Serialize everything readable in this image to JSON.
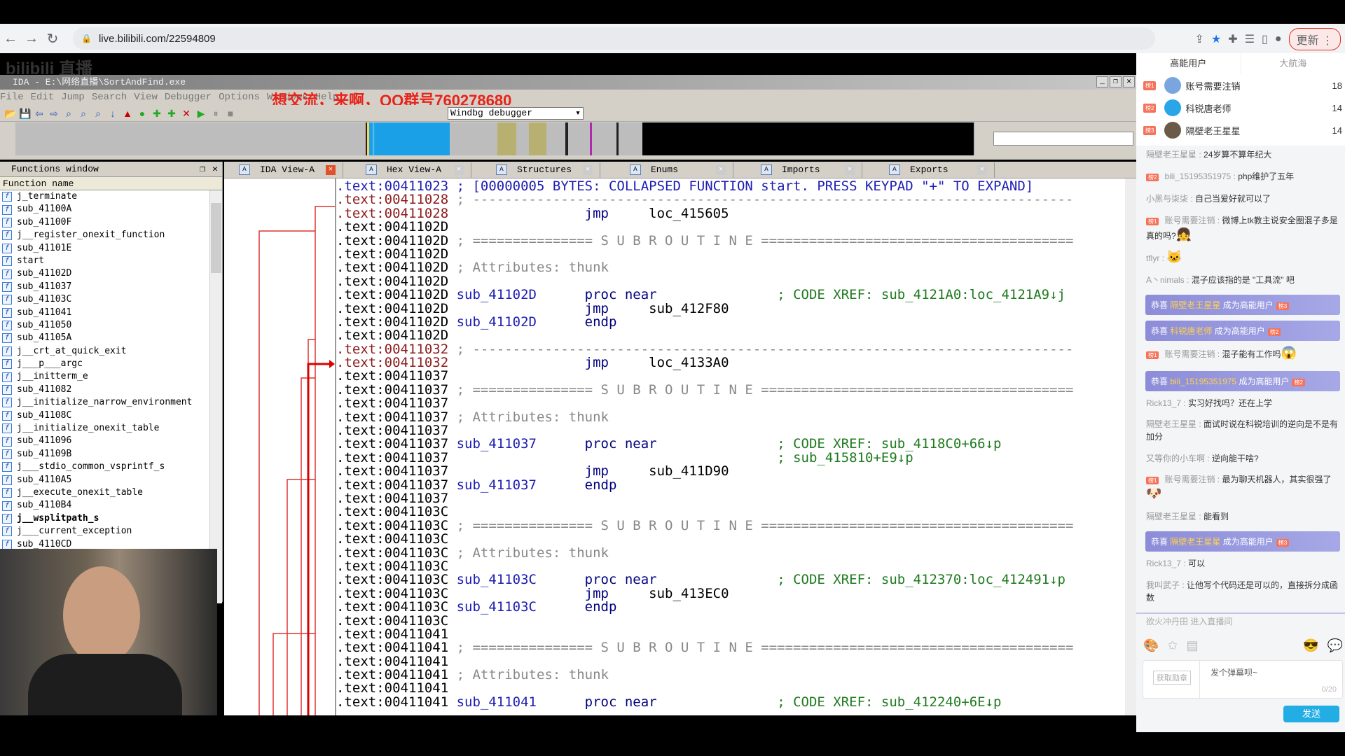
{
  "browser": {
    "url": "live.bilibili.com/22594809",
    "update_label": "更新",
    "icons": [
      "back-icon",
      "forward-icon",
      "reload-icon",
      "lock-icon",
      "share-icon",
      "star-icon",
      "extensions-icon",
      "reading-list-icon",
      "side-panel-icon",
      "profile-icon",
      "menu-icon"
    ]
  },
  "stream": {
    "watermark": "bilibili 直播",
    "overlay_text": "想交流，来啊，QQ群号760278680"
  },
  "ida": {
    "title": "IDA - E:\\网络直播\\SortAndFind.exe",
    "menu": [
      "File",
      "Edit",
      "Jump",
      "Search",
      "View",
      "Debugger",
      "Options",
      "Windows",
      "Help"
    ],
    "debugger_select": "Windbg debugger",
    "functions_window": {
      "title": "Functions window",
      "column": "Function name",
      "items": [
        "j_terminate",
        "sub_41100A",
        "sub_41100F",
        "j__register_onexit_function",
        "sub_41101E",
        "start",
        "sub_41102D",
        "sub_411037",
        "sub_41103C",
        "sub_411041",
        "sub_411050",
        "sub_41105A",
        "j__crt_at_quick_exit",
        "j___p___argc",
        "j__initterm_e",
        "sub_411082",
        "j__initialize_narrow_environment",
        "sub_41108C",
        "j__initialize_onexit_table",
        "sub_411096",
        "sub_41109B",
        "j___stdio_common_vsprintf_s",
        "sub_4110A5",
        "j__execute_onexit_table",
        "sub_4110B4",
        "j__wsplitpath_s",
        "j___current_exception",
        "sub_4110CD"
      ],
      "bold_item": "j__wsplitpath_s"
    },
    "tabs": [
      {
        "label": "IDA View-A",
        "active": true
      },
      {
        "label": "Hex View-A"
      },
      {
        "label": "Structures"
      },
      {
        "label": "Enums"
      },
      {
        "label": "Imports"
      },
      {
        "label": "Exports"
      }
    ],
    "colors": {
      "address_normal": "#000000",
      "address_unexplored": "#8b1c1c",
      "name": "#1c1cb4",
      "comment": "#1f7a1f",
      "overlay": "#e8231a"
    },
    "disasm": [
      {
        "addr": ".text:00411023",
        "ac": "a-blue",
        "text": "; [00000005 BYTES: COLLAPSED FUNCTION start. PRESS KEYPAD \"+\" TO EXPAND]",
        "tc": "c-blue"
      },
      {
        "addr": ".text:00411028",
        "ac": "a-red",
        "text": "; ---------------------------------------------------------------------------",
        "tc": "c-gray"
      },
      {
        "addr": ".text:00411028",
        "ac": "a-red",
        "op": "jmp",
        "arg": "loc_415605"
      },
      {
        "addr": ".text:0041102D"
      },
      {
        "addr": ".text:0041102D",
        "text": "; =============== S U B R O U T I N E =======================================",
        "tc": "c-gray"
      },
      {
        "addr": ".text:0041102D"
      },
      {
        "addr": ".text:0041102D",
        "text": "; Attributes: thunk",
        "tc": "c-gray"
      },
      {
        "addr": ".text:0041102D"
      },
      {
        "addr": ".text:0041102D",
        "label": "sub_41102D",
        "op": "proc near",
        "comment": "; CODE XREF: sub_4121A0:loc_4121A9↓j"
      },
      {
        "addr": ".text:0041102D",
        "op": "jmp",
        "arg": "sub_412F80"
      },
      {
        "addr": ".text:0041102D",
        "label": "sub_41102D",
        "op": "endp"
      },
      {
        "addr": ".text:0041102D"
      },
      {
        "addr": ".text:00411032",
        "ac": "a-red",
        "text": "; ---------------------------------------------------------------------------",
        "tc": "c-gray"
      },
      {
        "addr": ".text:00411032",
        "ac": "a-red",
        "op": "jmp",
        "arg": "loc_4133A0"
      },
      {
        "addr": ".text:00411037"
      },
      {
        "addr": ".text:00411037",
        "text": "; =============== S U B R O U T I N E =======================================",
        "tc": "c-gray"
      },
      {
        "addr": ".text:00411037"
      },
      {
        "addr": ".text:00411037",
        "text": "; Attributes: thunk",
        "tc": "c-gray"
      },
      {
        "addr": ".text:00411037"
      },
      {
        "addr": ".text:00411037",
        "label": "sub_411037",
        "op": "proc near",
        "comment": "; CODE XREF: sub_4118C0+66↓p"
      },
      {
        "addr": ".text:00411037",
        "comment": "; sub_415810+E9↓p"
      },
      {
        "addr": ".text:00411037",
        "op": "jmp",
        "arg": "sub_411D90"
      },
      {
        "addr": ".text:00411037",
        "label": "sub_411037",
        "op": "endp"
      },
      {
        "addr": ".text:00411037"
      },
      {
        "addr": ".text:0041103C"
      },
      {
        "addr": ".text:0041103C",
        "text": "; =============== S U B R O U T I N E =======================================",
        "tc": "c-gray"
      },
      {
        "addr": ".text:0041103C"
      },
      {
        "addr": ".text:0041103C",
        "text": "; Attributes: thunk",
        "tc": "c-gray"
      },
      {
        "addr": ".text:0041103C"
      },
      {
        "addr": ".text:0041103C",
        "label": "sub_41103C",
        "op": "proc near",
        "comment": "; CODE XREF: sub_412370:loc_412491↓p"
      },
      {
        "addr": ".text:0041103C",
        "op": "jmp",
        "arg": "sub_413EC0"
      },
      {
        "addr": ".text:0041103C",
        "label": "sub_41103C",
        "op": "endp"
      },
      {
        "addr": ".text:0041103C"
      },
      {
        "addr": ".text:00411041"
      },
      {
        "addr": ".text:00411041",
        "text": "; =============== S U B R O U T I N E =======================================",
        "tc": "c-gray"
      },
      {
        "addr": ".text:00411041"
      },
      {
        "addr": ".text:00411041",
        "text": "; Attributes: thunk",
        "tc": "c-gray"
      },
      {
        "addr": ".text:00411041"
      },
      {
        "addr": ".text:00411041",
        "label": "sub_411041",
        "op": "proc near",
        "comment": "; CODE XREF: sub_412240+6E↓p"
      }
    ]
  },
  "chat": {
    "tabs": [
      "高能用户",
      "大航海"
    ],
    "ranking": [
      {
        "badge": "榜1",
        "name": "账号需要注销",
        "value": "18",
        "avatar": "#7aa6e0"
      },
      {
        "badge": "榜2",
        "name": "科锐唐老师",
        "value": "14",
        "avatar": "#2aa5e8"
      },
      {
        "badge": "榜3",
        "name": "隔壁老王星星",
        "value": "14",
        "avatar": "#6b5a48"
      }
    ],
    "messages": [
      {
        "user": "隔壁老王星星",
        "text": "24岁算不算年纪大"
      },
      {
        "badge": "榜2",
        "user": "bili_15195351975",
        "text": "php维护了五年"
      },
      {
        "user": "小黑与柒柒",
        "text": "自己当爱好就可以了"
      },
      {
        "badge": "榜1",
        "user": "账号需要注销",
        "text": "微博上tk教主说安全圈混子多是真的吗?",
        "emoji": "👧"
      },
      {
        "user": "tflyr",
        "text": "",
        "emoji": "🐱"
      },
      {
        "user": "A丶nimals",
        "text": "混子应该指的是 \"工具流\" 吧"
      },
      {
        "system": true,
        "prefix": "恭喜",
        "user": "隔壁老王星星",
        "text": "成为高能用户",
        "badge": "榜3"
      },
      {
        "system": true,
        "prefix": "恭喜",
        "user": "科锐唐老师",
        "text": "成为高能用户",
        "badge": "榜2"
      },
      {
        "badge": "榜1",
        "user": "账号需要注销",
        "text": "混子能有工作吗",
        "emoji": "😱"
      },
      {
        "system": true,
        "prefix": "恭喜",
        "user": "bili_15195351975",
        "text": "成为高能用户",
        "badge": "榜2"
      },
      {
        "user": "Rick13_7",
        "text": "实习好找吗？还在上学"
      },
      {
        "user": "隔壁老王星星",
        "text": "面试时说在科锐培训的逆向是不是有加分"
      },
      {
        "user": "又等你的小车啊",
        "text": "逆向能干啥?"
      },
      {
        "badge": "榜1",
        "user": "账号需要注销",
        "text": "最为聊天机器人，其实很强了",
        "emoji": "🐶"
      },
      {
        "user": "隔壁老王星星",
        "text": "能看到"
      },
      {
        "system": true,
        "prefix": "恭喜",
        "user": "隔壁老王星星",
        "text": "成为高能用户",
        "badge": "榜3"
      },
      {
        "user": "Rick13_7",
        "text": "可以"
      },
      {
        "user": "我叫武子",
        "text": "让他写个代码还是可以的，直接拆分成函数"
      }
    ],
    "enter_notice": "欲火冲丹田 进入直播间",
    "medal_label": "获取勋章",
    "input_placeholder": "发个弹幕呗~",
    "char_count": "0/20",
    "send_label": "发送"
  }
}
